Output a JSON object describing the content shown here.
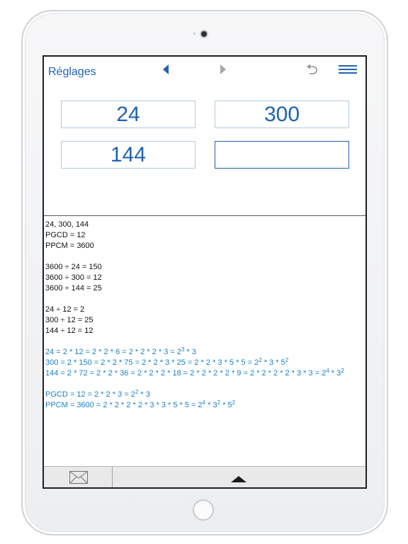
{
  "toolbar": {
    "settings_label": "Réglages",
    "back_icon": "arrow-left-icon",
    "forward_icon": "arrow-right-icon",
    "undo_icon": "undo-icon",
    "menu_icon": "menu-icon"
  },
  "inputs": {
    "field_1": "24",
    "field_2": "300",
    "field_3": "144",
    "field_4": ""
  },
  "results": {
    "numbers": "24, 300, 144",
    "pgcd": "PGCD = 12",
    "ppcm": "PPCM = 3600",
    "div_ppcm_1": "3600 ÷ 24 = 150",
    "div_ppcm_2": "3600 ÷ 300 = 12",
    "div_ppcm_3": "3600 ÷ 144 = 25",
    "div_pgcd_1": "24 ÷ 12 = 2",
    "div_pgcd_2": "300 ÷ 12 = 25",
    "div_pgcd_3": "144 ÷ 12 = 12",
    "f24_main": "24 = 2 * 12 = 2 * 2 * 6 = 2 * 2 * 2 * 3 = 2",
    "f24_e1": "3",
    "f24_t1": " * 3",
    "f300_main": "300 = 2 * 150 = 2 * 2 * 75 = 2 * 2 * 3 * 25 = 2 * 2 * 3 * 5 * 5 = 2",
    "f300_e1": "2",
    "f300_t1": " * 3 * 5",
    "f300_e2": "2",
    "f144_main": "144 = 2 * 72 = 2 * 2 * 36 = 2 * 2 * 2 * 18 = 2 * 2 * 2 * 2 * 9 = 2 * 2 * 2 * 2 * 3 * 3 = 2",
    "f144_e1": "4",
    "f144_t1": " * 3",
    "f144_e2": "2",
    "pgcd_main": "PGCD = 12 = 2 * 2 * 3 = 2",
    "pgcd_e1": "2",
    "pgcd_t1": " * 3",
    "ppcm_main": "PPCM = 3600 = 2 * 2 * 2 * 2 * 3 * 3 * 5 * 5 = 2",
    "ppcm_e1": "4",
    "ppcm_t1": " * 3",
    "ppcm_e2": "2",
    "ppcm_t2": " * 5",
    "ppcm_e3": "2"
  },
  "bottom_bar": {
    "mail_icon": "envelope-icon",
    "expand_icon": "triangle-up-icon"
  },
  "colors": {
    "accent": "#1f62b3",
    "result_blue": "#1a7fc6"
  }
}
